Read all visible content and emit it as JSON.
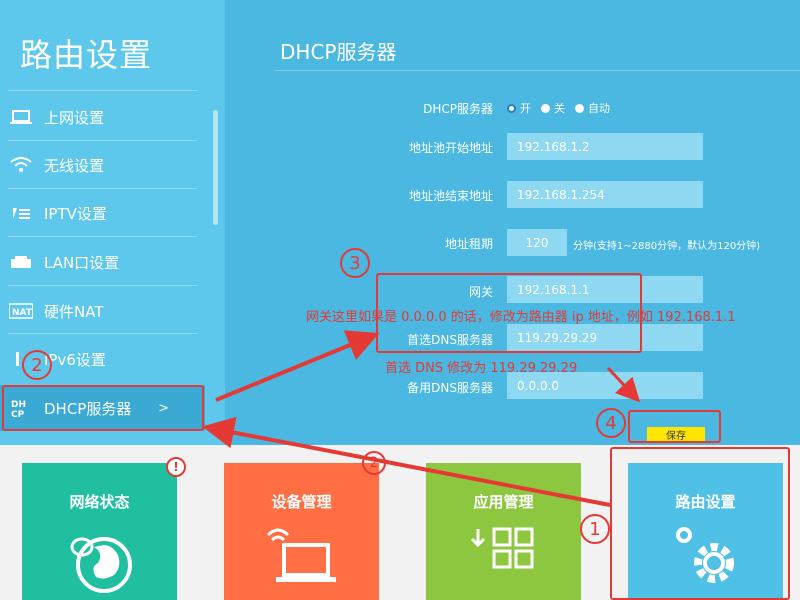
{
  "sidebar": {
    "title": "路由设置",
    "items": [
      {
        "label": "上网设置",
        "icon": "laptop-icon"
      },
      {
        "label": "无线设置",
        "icon": "wifi-icon"
      },
      {
        "label": "IPTV设置",
        "icon": "iptv-icon"
      },
      {
        "label": "LAN口设置",
        "icon": "lan-icon"
      },
      {
        "label": "硬件NAT",
        "icon": "nat-icon"
      },
      {
        "label": "IPv6设置",
        "icon": "ipv6-icon"
      },
      {
        "label": "DHCP服务器",
        "icon": "dhcp-icon",
        "chevron": ">"
      }
    ]
  },
  "main": {
    "title": "DHCP服务器",
    "dhcp_label": "DHCP服务器",
    "dhcp_options": [
      "开",
      "关",
      "自动"
    ],
    "dhcp_selected": "开",
    "pool_start_label": "地址池开始地址",
    "pool_start": "192.168.1.2",
    "pool_end_label": "地址池结束地址",
    "pool_end": "192.168.1.254",
    "lease_label": "地址租期",
    "lease": "120",
    "lease_hint": "分钟(支持1~2880分钟，默认为120分钟)",
    "gateway_label": "网关",
    "gateway": "192.168.1.1",
    "dns1_label": "首选DNS服务器",
    "dns1": "119.29.29.29",
    "dns2_label": "备用DNS服务器",
    "dns2": "0.0.0.0",
    "save_label": "保存"
  },
  "tiles": [
    {
      "label": "网络状态",
      "color": "#1fbfa0",
      "icon": "globe-icon"
    },
    {
      "label": "设备管理",
      "color": "#ff6f43",
      "icon": "laptop-wifi-icon"
    },
    {
      "label": "应用管理",
      "color": "#8dc63f",
      "icon": "apps-grid-icon"
    },
    {
      "label": "路由设置",
      "color": "#4fc0e6",
      "icon": "gear-icon"
    }
  ],
  "annotations": {
    "gateway_note": "网关这里如果是 0.0.0.0 的话，修改为路由器 ip 地址，例如 192.168.1.1",
    "dns_note": "首选 DNS 修改为 119.29.29.29",
    "n1": "1",
    "n2": "2",
    "n2b": "2",
    "n3": "3",
    "n4": "4",
    "excl": "!"
  },
  "colors": {
    "accent_red": "#e53935",
    "save_yellow": "#ffe600",
    "sidebar": "#5ec8ec",
    "main": "#4ab8e0"
  }
}
